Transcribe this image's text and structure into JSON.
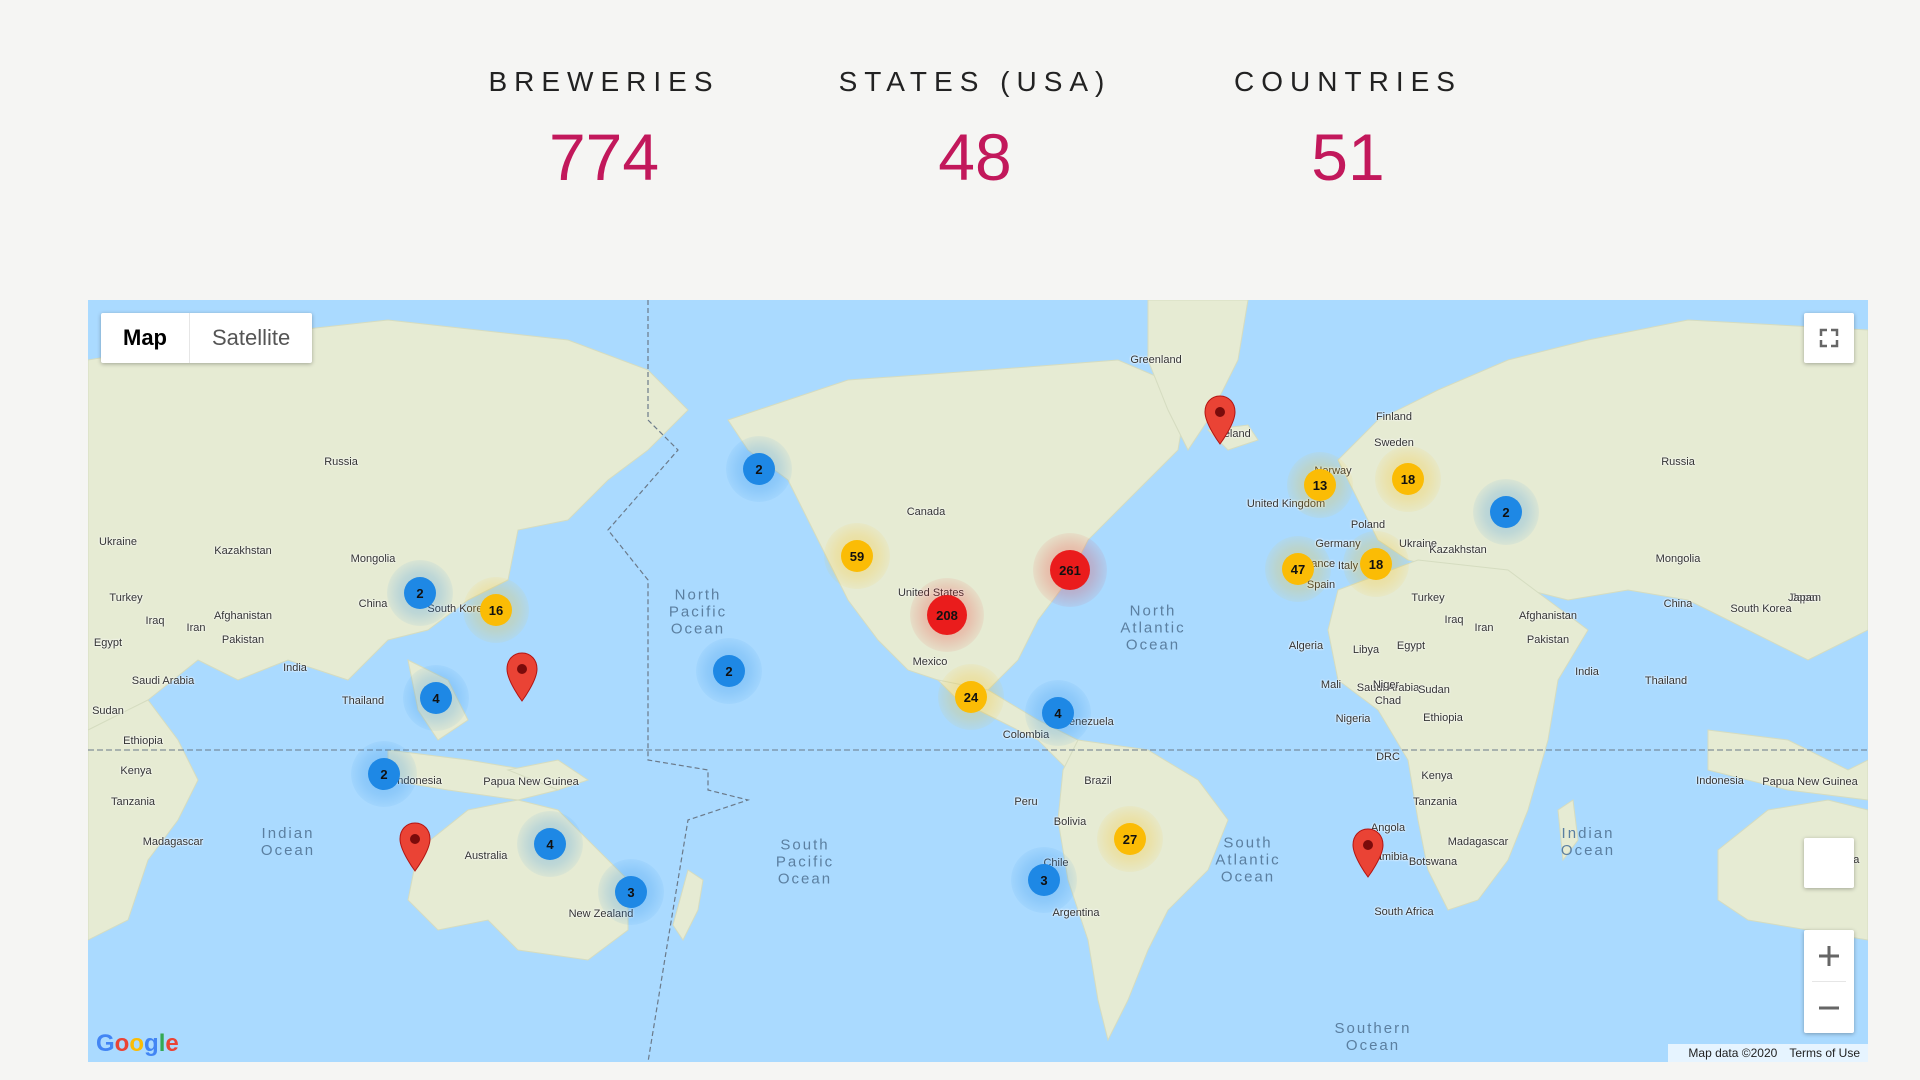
{
  "stats": [
    {
      "label": "BREWERIES",
      "value": "774"
    },
    {
      "label": "STATES (USA)",
      "value": "48"
    },
    {
      "label": "COUNTRIES",
      "value": "51"
    }
  ],
  "map": {
    "type_controls": {
      "map": "Map",
      "satellite": "Satellite"
    },
    "attribution": {
      "data": "Map data ©2020",
      "terms": "Terms of Use"
    },
    "logo": "Google",
    "colors": {
      "ocean": "#aadaff",
      "land": "#e8ecd5",
      "blue": "#1e88e5",
      "yellow": "#fbbc05",
      "red": "#ea1c1c",
      "pin": "#ea4335",
      "stat": "#c2185b"
    },
    "country_labels": [
      "Russia",
      "Kazakhstan",
      "Mongolia",
      "Ukraine",
      "Turkey",
      "China",
      "South Korea",
      "Iraq",
      "Iran",
      "Afghanistan",
      "Pakistan",
      "India",
      "Egypt",
      "Saudi Arabia",
      "Sudan",
      "Ethiopia",
      "Kenya",
      "Tanzania",
      "Madagascar",
      "Thailand",
      "Indonesia",
      "Papua New Guinea",
      "Australia",
      "New Zealand",
      "Canada",
      "United States",
      "Mexico",
      "Colombia",
      "Venezuela",
      "Peru",
      "Brazil",
      "Bolivia",
      "Chile",
      "Argentina",
      "Greenland",
      "Iceland",
      "Finland",
      "Sweden",
      "Norway",
      "United Kingdom",
      "Poland",
      "Germany",
      "Ukraine",
      "Italy",
      "Spain",
      "France",
      "Kazakhstan",
      "Mongolia",
      "Turkey",
      "Iraq",
      "Iran",
      "Afghanistan",
      "Pakistan",
      "China",
      "South Korea",
      "Japan",
      "Algeria",
      "Libya",
      "Egypt",
      "Saudi Arabia",
      "Mali",
      "Niger",
      "Chad",
      "Sudan",
      "Nigeria",
      "Ethiopia",
      "DRC",
      "Kenya",
      "Tanzania",
      "Angola",
      "Namibia",
      "Botswana",
      "Madagascar",
      "South Africa",
      "India",
      "Thailand",
      "Indonesia",
      "Papua New Guinea",
      "Australia",
      "Russia",
      "Japan"
    ],
    "oceans": [
      "North\nPacific\nOcean",
      "North\nAtlantic\nOcean",
      "South\nPacific\nOcean",
      "South\nAtlantic\nOcean",
      "Indian\nOcean",
      "Indian\nOcean",
      "Southern\nOcean"
    ],
    "clusters": [
      {
        "count": 2,
        "color": "blue",
        "region": "Alaska"
      },
      {
        "count": 2,
        "color": "blue",
        "region": "North Pacific"
      },
      {
        "count": 59,
        "color": "yellow",
        "region": "US West"
      },
      {
        "count": 208,
        "color": "red",
        "region": "US Central"
      },
      {
        "count": 261,
        "color": "red",
        "region": "US East"
      },
      {
        "count": 24,
        "color": "yellow",
        "region": "Mexico"
      },
      {
        "count": 4,
        "color": "blue",
        "region": "Caribbean"
      },
      {
        "count": 27,
        "color": "yellow",
        "region": "Brazil"
      },
      {
        "count": 3,
        "color": "blue",
        "region": "Chile"
      },
      {
        "count": 13,
        "color": "yellow",
        "region": "UK"
      },
      {
        "count": 18,
        "color": "yellow",
        "region": "Scandinavia"
      },
      {
        "count": 47,
        "color": "yellow",
        "region": "Western Europe"
      },
      {
        "count": 18,
        "color": "yellow",
        "region": "Central Europe"
      },
      {
        "count": 2,
        "color": "blue",
        "region": "Russia"
      },
      {
        "count": 2,
        "color": "blue",
        "region": "China"
      },
      {
        "count": 16,
        "color": "yellow",
        "region": "Japan"
      },
      {
        "count": 4,
        "color": "blue",
        "region": "Philippines"
      },
      {
        "count": 2,
        "color": "blue",
        "region": "Indonesia"
      },
      {
        "count": 4,
        "color": "blue",
        "region": "East Australia"
      },
      {
        "count": 3,
        "color": "blue",
        "region": "New Zealand"
      }
    ]
  }
}
